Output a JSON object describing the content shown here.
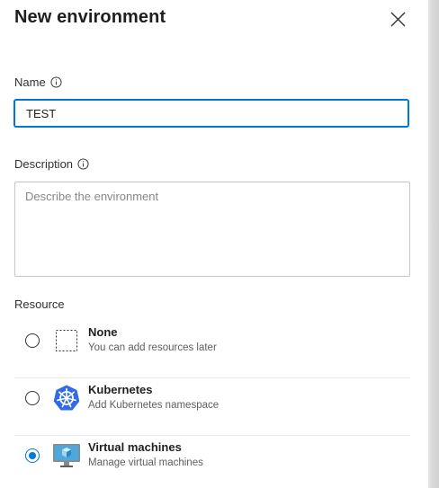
{
  "dialog": {
    "title": "New environment"
  },
  "name_field": {
    "label": "Name",
    "value": "TEST"
  },
  "description_field": {
    "label": "Description",
    "placeholder": "Describe the environment",
    "value": ""
  },
  "resource": {
    "label": "Resource",
    "selected": "Virtual machines",
    "options": [
      {
        "title": "None",
        "subtitle": "You can add resources later",
        "icon": "dashed-square-icon",
        "checked": false
      },
      {
        "title": "Kubernetes",
        "subtitle": "Add Kubernetes namespace",
        "icon": "kubernetes-icon",
        "checked": false
      },
      {
        "title": "Virtual machines",
        "subtitle": "Manage virtual machines",
        "icon": "virtual-machine-icon",
        "checked": true
      }
    ]
  },
  "colors": {
    "accent": "#0078d4",
    "kubernetes": "#326ce5",
    "vm_screen": "#4aa8d8"
  }
}
